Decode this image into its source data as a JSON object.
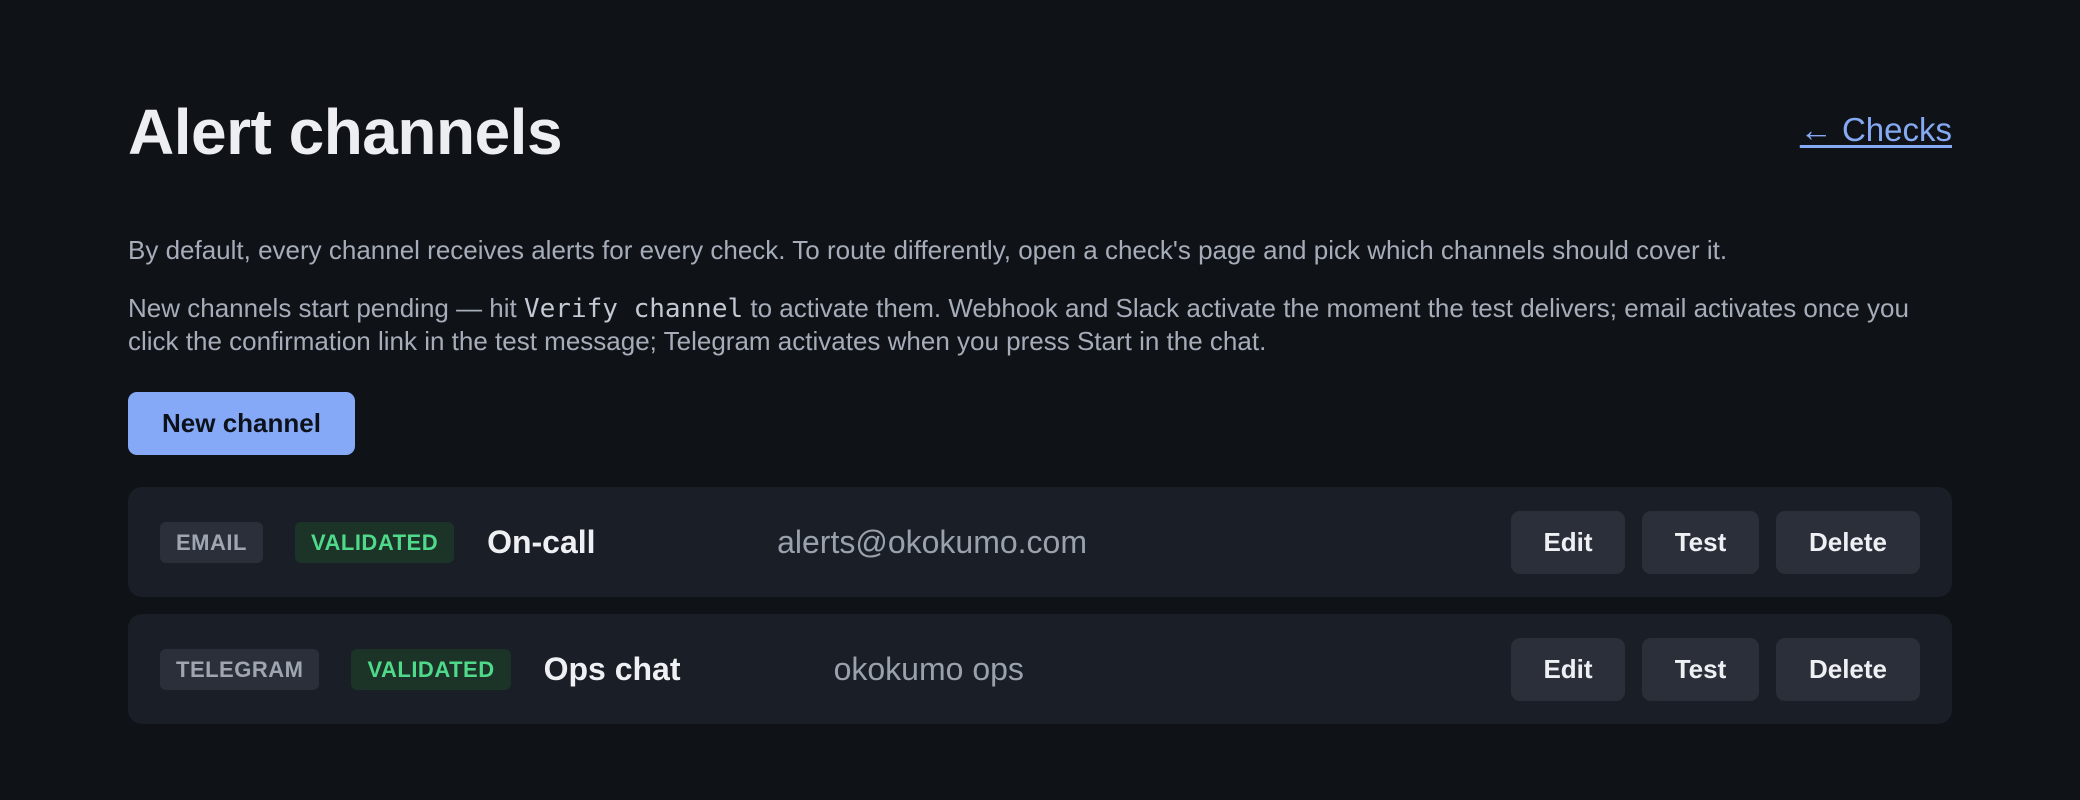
{
  "header": {
    "title": "Alert channels",
    "back_link": "← Checks"
  },
  "intro": {
    "paragraph1": "By default, every channel receives alerts for every check. To route differently, open a check's page and pick which channels should cover it.",
    "paragraph2_before": "New channels start pending — hit ",
    "paragraph2_code": "Verify channel",
    "paragraph2_after": " to activate them. Webhook and Slack activate the moment the test delivers; email activates once you click the confirmation link in the test message; Telegram activates when you press Start in the chat."
  },
  "new_channel_button": "New channel",
  "channels": [
    {
      "type": "EMAIL",
      "status": "VALIDATED",
      "name": "On-call",
      "target": "alerts@okokumo.com",
      "actions": {
        "edit": "Edit",
        "test": "Test",
        "delete": "Delete"
      }
    },
    {
      "type": "TELEGRAM",
      "status": "VALIDATED",
      "name": "Ops chat",
      "target": "okokumo ops",
      "actions": {
        "edit": "Edit",
        "test": "Test",
        "delete": "Delete"
      }
    }
  ],
  "colors": {
    "background": "#0f1318",
    "accent": "#86a9f7",
    "validated": "#4fd98a",
    "row_background": "#1a1e26"
  }
}
